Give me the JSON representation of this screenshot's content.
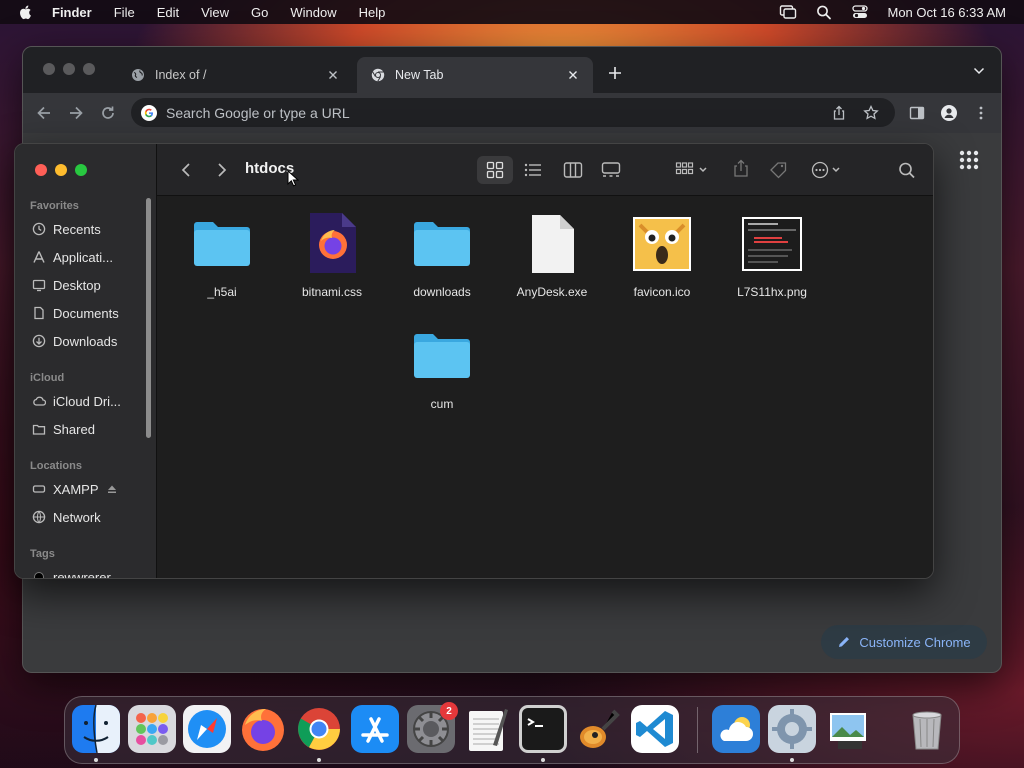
{
  "menubar": {
    "app_name": "Finder",
    "menus": [
      "File",
      "Edit",
      "View",
      "Go",
      "Window",
      "Help"
    ],
    "clock": "Mon Oct 16  6:33 AM"
  },
  "browser": {
    "tabs": [
      {
        "title": "Index of /",
        "active": false,
        "icon": "globe-icon"
      },
      {
        "title": "New Tab",
        "active": true,
        "icon": "chrome-icon"
      }
    ],
    "omnibox": {
      "placeholder": "Search Google or type a URL",
      "value": ""
    },
    "customize_label": "Customize Chrome",
    "theme": {
      "frame": "#202124",
      "toolbar": "#35363a",
      "accent": "#8ab4f8"
    }
  },
  "finder": {
    "title": "htdocs",
    "sidebar": {
      "favorites_label": "Favorites",
      "favorites": [
        {
          "label": "Recents",
          "icon": "clock-icon"
        },
        {
          "label": "Applicati...",
          "icon": "applications-icon"
        },
        {
          "label": "Desktop",
          "icon": "desktop-icon"
        },
        {
          "label": "Documents",
          "icon": "document-icon"
        },
        {
          "label": "Downloads",
          "icon": "download-icon"
        }
      ],
      "icloud_label": "iCloud",
      "icloud": [
        {
          "label": "iCloud Dri...",
          "icon": "cloud-icon"
        },
        {
          "label": "Shared",
          "icon": "shared-folder-icon"
        }
      ],
      "locations_label": "Locations",
      "locations": [
        {
          "label": "XAMPP",
          "icon": "disk-icon"
        },
        {
          "label": "Network",
          "icon": "globe-icon"
        }
      ],
      "tags_label": "Tags",
      "tags": [
        {
          "label": "rewwrerer",
          "color": "#000000"
        }
      ]
    },
    "files": [
      {
        "name": "_h5ai",
        "kind": "folder"
      },
      {
        "name": "bitnami.css",
        "kind": "firefox-doc"
      },
      {
        "name": "downloads",
        "kind": "folder"
      },
      {
        "name": "AnyDesk.exe",
        "kind": "blank-doc"
      },
      {
        "name": "favicon.ico",
        "kind": "image"
      },
      {
        "name": "L7S11hx.png",
        "kind": "screenshot"
      },
      {
        "name": "cum",
        "kind": "folder"
      }
    ]
  },
  "dock": {
    "apps": [
      "Finder",
      "Launchpad",
      "Safari",
      "Firefox",
      "Google Chrome",
      "App Store",
      "System Settings",
      "TextEdit",
      "Terminal",
      "GarageBand",
      "Visual Studio Code",
      "Weather",
      "System Preferences",
      "Preview"
    ],
    "settings_badge": "2",
    "trash": "Trash"
  }
}
